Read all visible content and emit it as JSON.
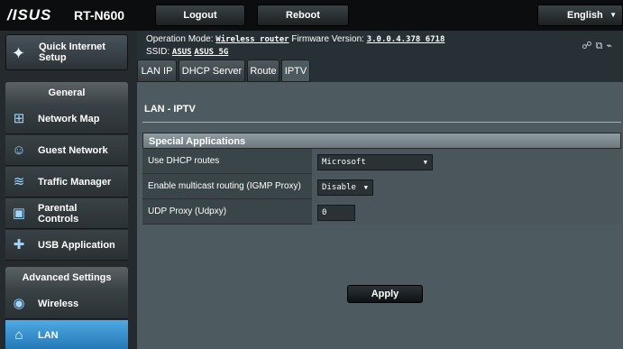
{
  "brand": {
    "logo": "/ISUS",
    "model": "RT-N600"
  },
  "topbar": {
    "logout_label": "Logout",
    "reboot_label": "Reboot",
    "language": "English"
  },
  "sidebar": {
    "quick_setup": "Quick Internet Setup",
    "general_header": "General",
    "general_items": [
      {
        "label": "Network Map",
        "icon": "network-map-icon"
      },
      {
        "label": "Guest Network",
        "icon": "guest-network-icon"
      },
      {
        "label": "Traffic Manager",
        "icon": "traffic-manager-icon"
      },
      {
        "label": "Parental Controls",
        "icon": "parental-controls-icon"
      },
      {
        "label": "USB Application",
        "icon": "usb-application-icon"
      }
    ],
    "advanced_header": "Advanced Settings",
    "advanced_items": [
      {
        "label": "Wireless",
        "icon": "wireless-icon"
      },
      {
        "label": "LAN",
        "icon": "lan-icon",
        "active": true
      }
    ]
  },
  "header": {
    "operation_mode_label": "Operation Mode:",
    "operation_mode_value": "Wireless router",
    "firmware_label": "Firmware Version:",
    "firmware_value": "3.0.0.4.378_6718",
    "ssid_label": "SSID:",
    "ssid_1": "ASUS",
    "ssid_2": "ASUS_5G"
  },
  "tabs": [
    {
      "label": "LAN IP"
    },
    {
      "label": "DHCP Server"
    },
    {
      "label": "Route"
    },
    {
      "label": "IPTV",
      "active": true
    }
  ],
  "page": {
    "title": "LAN - IPTV",
    "section_title": "Special Applications",
    "rows": [
      {
        "label": "Use DHCP routes",
        "value": "Microsoft"
      },
      {
        "label": "Enable multicast routing (IGMP Proxy)",
        "value": "Disable"
      },
      {
        "label": "UDP Proxy (Udpxy)",
        "value": "0"
      }
    ],
    "apply_label": "Apply"
  },
  "colors": {
    "accent": "#2b86c8",
    "background": "#1d2225",
    "panel": "#4d5a60"
  }
}
